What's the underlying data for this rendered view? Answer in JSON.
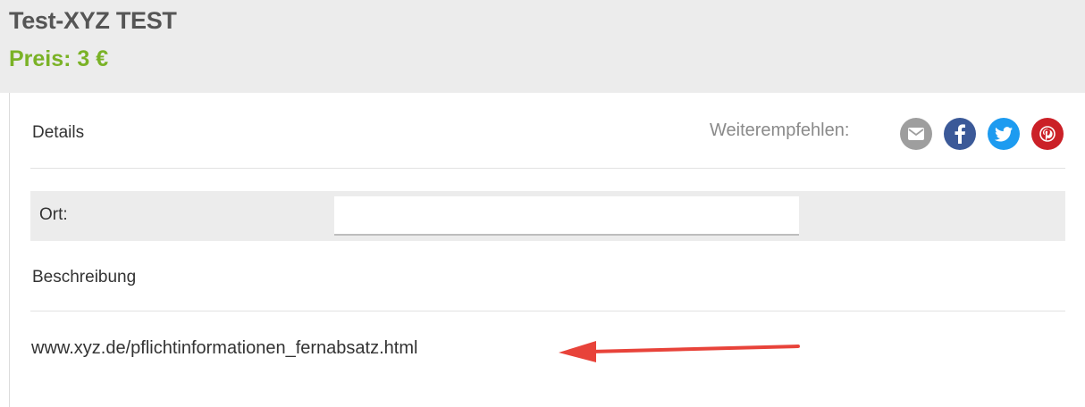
{
  "header": {
    "title": "Test-XYZ TEST",
    "price": "Preis: 3 €"
  },
  "details": {
    "title": "Details",
    "share_label": "Weiterempfehlen:",
    "share_icons": [
      "email-icon",
      "facebook-icon",
      "twitter-icon",
      "pinterest-icon"
    ]
  },
  "fields": {
    "ort_label": "Ort:",
    "ort_value": ""
  },
  "description": {
    "title": "Beschreibung",
    "text": "www.xyz.de/pflichtinformationen_fernabsatz.html"
  },
  "colors": {
    "price_green": "#7ab226",
    "arrow_red": "#e8433a",
    "facebook": "#3b5998",
    "twitter": "#1d9bf0",
    "pinterest": "#cb2027",
    "email": "#9e9e9e"
  }
}
